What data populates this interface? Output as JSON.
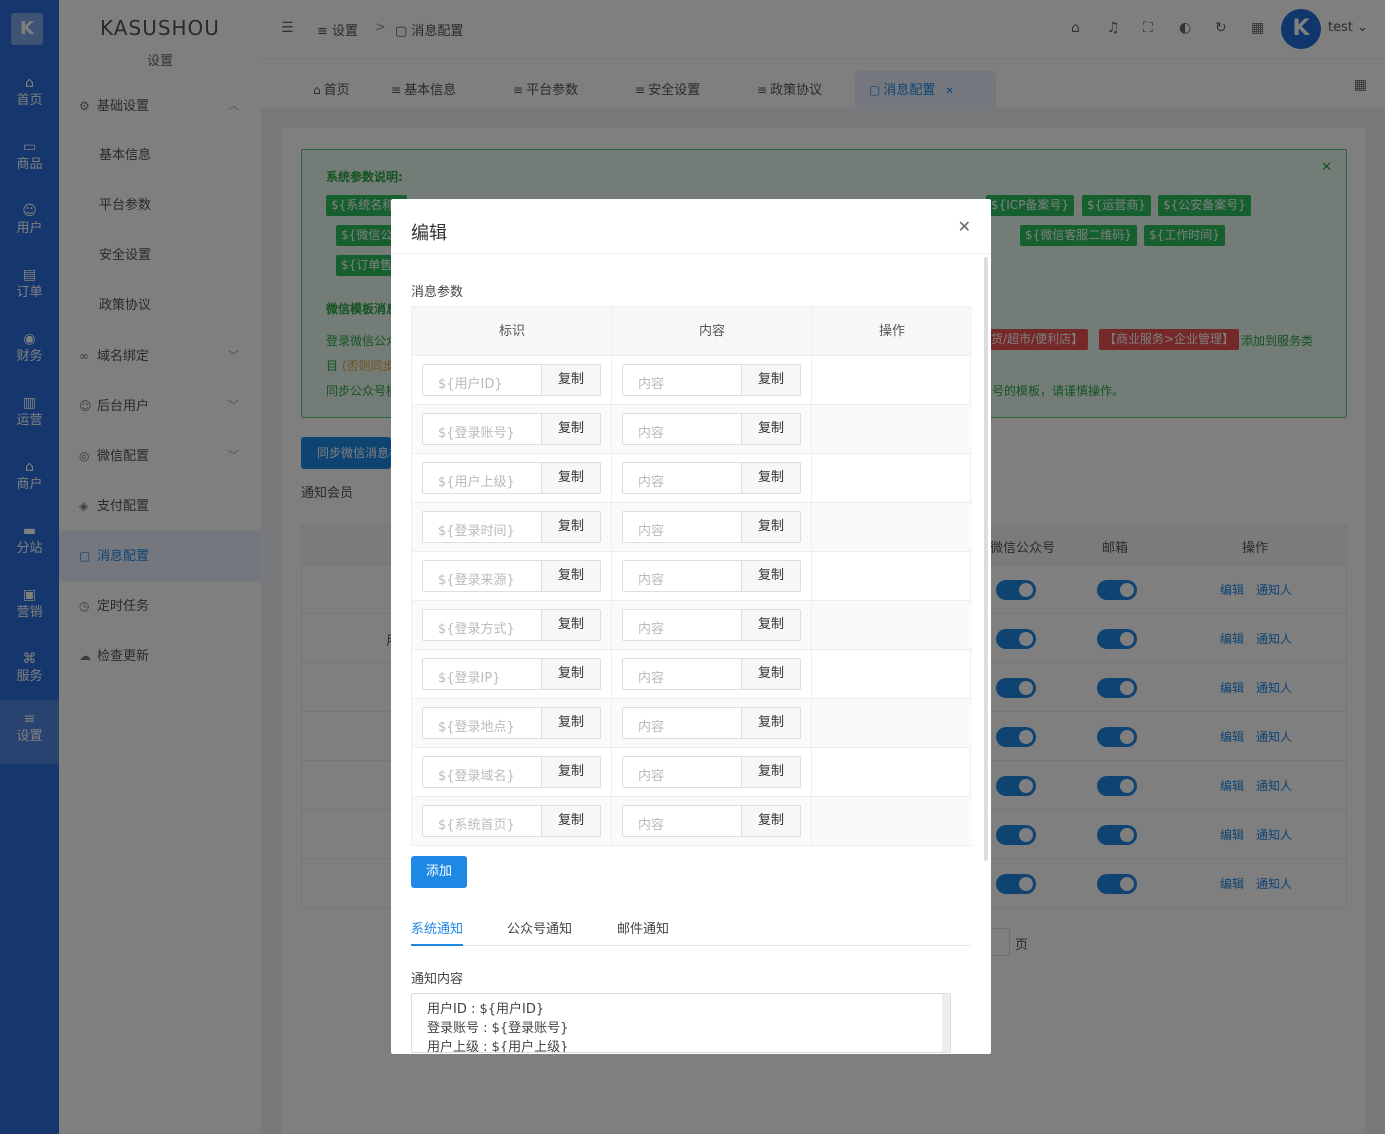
{
  "rail": {
    "logo": "K",
    "items": [
      "首页",
      "商品",
      "用户",
      "订单",
      "财务",
      "运营",
      "商户",
      "分站",
      "营销",
      "服务",
      "设置"
    ],
    "icons": [
      "home-icon",
      "goods-icon",
      "user-icon",
      "order-icon",
      "finance-icon",
      "operation-icon",
      "merchant-icon",
      "substation-icon",
      "marketing-icon",
      "service-icon",
      "settings-icon"
    ]
  },
  "sidebar": {
    "brand": "KASUSHOU",
    "subtitle": "设置",
    "items": [
      {
        "label": "基础设置",
        "icon": "gear-icon"
      },
      {
        "label": "基本信息"
      },
      {
        "label": "平台参数"
      },
      {
        "label": "安全设置"
      },
      {
        "label": "政策协议"
      },
      {
        "label": "域名绑定",
        "icon": "link-icon"
      },
      {
        "label": "后台用户",
        "icon": "user-icon"
      },
      {
        "label": "微信配置",
        "icon": "wechat-icon"
      },
      {
        "label": "支付配置",
        "icon": "pay-icon"
      },
      {
        "label": "消息配置",
        "icon": "message-icon"
      },
      {
        "label": "定时任务",
        "icon": "clock-icon"
      },
      {
        "label": "检查更新",
        "icon": "cloud-icon"
      }
    ]
  },
  "header": {
    "breadcrumb": [
      "设置",
      "消息配置"
    ],
    "sep": ">",
    "username": "test",
    "avatar_letter": "K"
  },
  "tabs": [
    {
      "label": "首页"
    },
    {
      "label": "基本信息"
    },
    {
      "label": "平台参数"
    },
    {
      "label": "安全设置"
    },
    {
      "label": "政策协议"
    },
    {
      "label": "消息配置"
    }
  ],
  "alert": {
    "title": "系统参数说明:",
    "row1_tags": [
      "${系统名称}",
      "${ICP备案号}",
      "${运营商}",
      "${公安备案号}"
    ],
    "row2_tags": [
      "${微信公众号}",
      "${微信客服二维码}",
      "${工作时间}"
    ],
    "row3_tags": [
      "${订单售后}"
    ],
    "wx_title": "微信模板消息",
    "wx_line1_start": "登录微信公众",
    "wx_line1_tag1": "货/超市/便利店】",
    "wx_line1_tag2": "【商业服务>企业管理】",
    "wx_line1_end": "添加到服务类",
    "wx_line2_start": "目",
    "wx_line2_warn": "(否则同步",
    "wx_line3_start": "同步公众号模",
    "wx_line3_end": "号的模板，请谨慎操作。"
  },
  "page": {
    "sync_button": "同步微信消息模板",
    "notify_label": "通知会员",
    "col_wechat": "微信公众号",
    "col_email": "邮箱",
    "col_action": "操作",
    "edit_link": "编辑",
    "notify_link": "通知人",
    "row_text": "用",
    "page_suffix": "页"
  },
  "modal": {
    "title": "编辑",
    "section_params": "消息参数",
    "headers": [
      "标识",
      "内容",
      "操作"
    ],
    "params": [
      "${用户ID}",
      "${登录账号}",
      "${用户上级}",
      "${登录时间}",
      "${登录来源}",
      "${登录方式}",
      "${登录IP}",
      "${登录地点}",
      "${登录域名}",
      "${系统首页}"
    ],
    "content_placeholder": "内容",
    "copy_label": "复制",
    "add_button": "添加",
    "notify_tabs": [
      "系统通知",
      "公众号通知",
      "邮件通知"
    ],
    "notify_content_label": "通知内容",
    "notify_lines": [
      "用户ID : ${用户ID}",
      "登录账号 : ${登录账号}",
      "用户上级 : ${用户上级}"
    ]
  },
  "colors": {
    "primary": "#1e88e5",
    "rail": "#2a6fdb",
    "success": "#28a745",
    "danger": "#e8504f"
  }
}
